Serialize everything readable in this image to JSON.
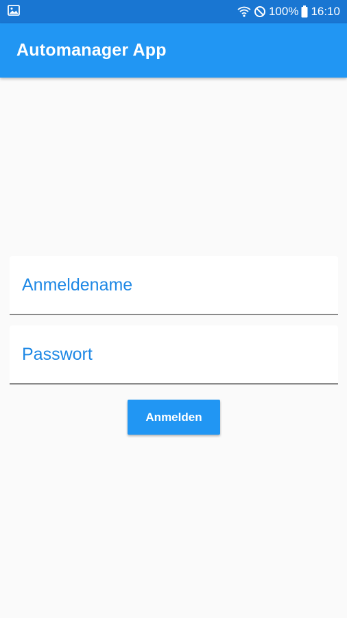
{
  "status_bar": {
    "battery": "100%",
    "time": "16:10",
    "icons": [
      "image-icon",
      "wifi-icon",
      "do-not-disturb-icon",
      "battery-icon"
    ]
  },
  "app_bar": {
    "title": "Automanager App"
  },
  "login_form": {
    "username": {
      "placeholder": "Anmeldename",
      "value": ""
    },
    "password": {
      "placeholder": "Passwort",
      "value": ""
    },
    "submit_label": "Anmelden"
  },
  "colors": {
    "status_bar": "#1976d2",
    "primary": "#2196f3",
    "field_text": "#1e88e5",
    "background": "#fafafa"
  }
}
